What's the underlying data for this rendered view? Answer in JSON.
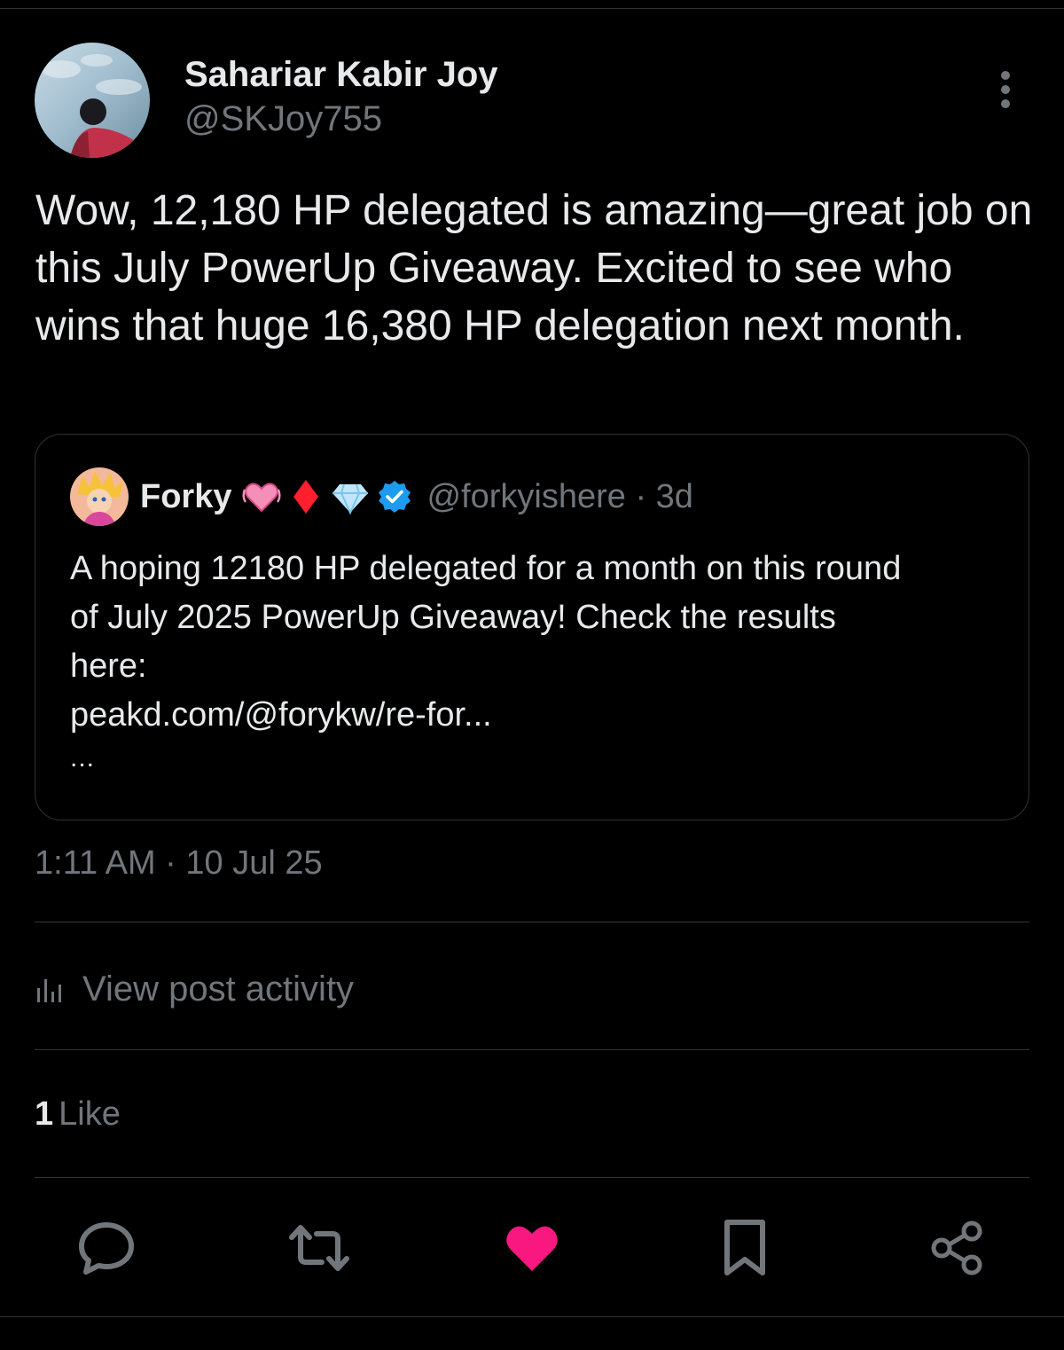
{
  "post": {
    "author": {
      "name": "Sahariar Kabir Joy",
      "handle": "@SKJoy755"
    },
    "text": "Wow, 12,180 HP delegated is amazing—great job on this July PowerUp Giveaway. Excited to see who wins that huge 16,380 HP delegation next month.",
    "timestamp": "1:11 AM · 10 Jul 25",
    "view_activity_label": "View post activity",
    "likes": {
      "count": "1",
      "label": "Like"
    }
  },
  "quote": {
    "author_name": "Forky",
    "emojis": [
      "heart-pulse-emoji",
      "red-diamond-emoji",
      "gem-emoji"
    ],
    "verified_icon": "verified-badge-icon",
    "handle_time": "@forkyishere · 3d",
    "text_lines": [
      "A hoping 12180 HP delegated for a month on this round",
      "of July 2025 PowerUp Giveaway! Check the results",
      "here:",
      "peakd.com/@forykw/re-for..."
    ],
    "ellipsis": "..."
  },
  "actions": {
    "icons": [
      "reply-icon",
      "repost-icon",
      "like-icon",
      "bookmark-icon",
      "share-icon"
    ],
    "liked": true
  },
  "colors": {
    "background": "#000000",
    "primary_text": "#e7e9ea",
    "secondary_text": "#71767b",
    "divider": "#2f3336",
    "like_active": "#f91880",
    "verified": "#1d9bf0"
  }
}
